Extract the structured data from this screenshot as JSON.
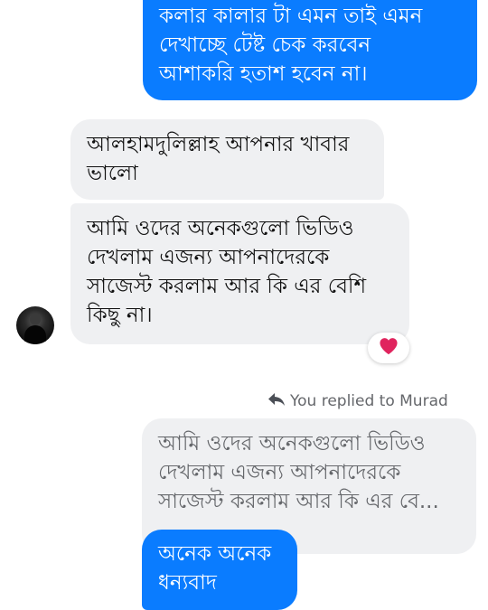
{
  "conversation": {
    "outgoing_1": "কলার কালার টা এমন তাই এমন\nদেখাচ্ছে টেষ্ট চেক করবেন\nআশাকরি হতাশ হবেন না।",
    "incoming_1": "আলহামদুলিল্লাহ আপনার খাবার\nভালো",
    "incoming_2": "আমি ওদের অনেকগুলো ভিডিও\nদেখলাম এজন্য আপনাদেরকে\nসাজেস্ট করলাম আর কি এর বেশি\nকিছু না।",
    "reaction_icon": "red-heart-icon",
    "reply_note": "You replied to Murad",
    "quoted_text": "আমি ওদের অনেকগুলো ভিডিও\nদেখলাম এজন্য আপনাদেরকে\nসাজেস্ট করলাম আর কি এর বে...",
    "outgoing_2": "অনেক অনেক\nধন্যবাদ"
  },
  "colors": {
    "outgoing_bubble": "#0a7cff",
    "incoming_bubble": "#eff0f2",
    "heart": "#e0245e",
    "meta_text": "#65676b"
  }
}
